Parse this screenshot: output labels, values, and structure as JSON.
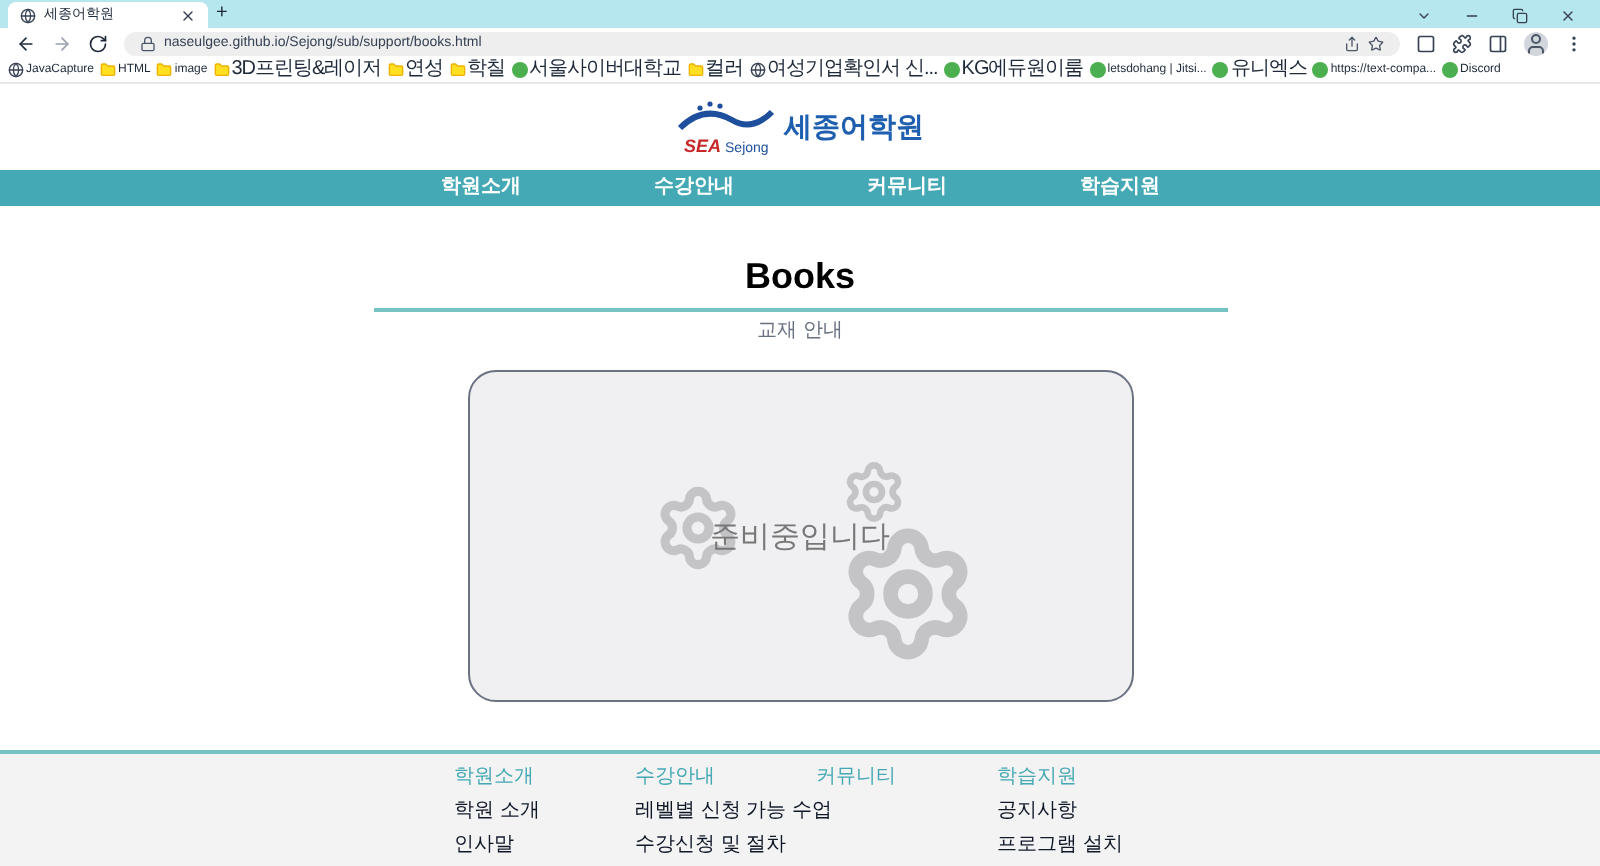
{
  "browser": {
    "tabs": [
      {
        "title": "세종어학원",
        "selected": true
      }
    ],
    "new_tab": "+",
    "url": "naseulgee.github.io/Sejong/sub/support/books.html",
    "bookmarks": [
      {
        "label": "JavaCapture",
        "kind": "globe"
      },
      {
        "label": "HTML",
        "kind": "folder"
      },
      {
        "label": "image",
        "kind": "folder"
      },
      {
        "label": "3D프린팅&레이저",
        "kind": "folder"
      },
      {
        "label": "연성",
        "kind": "folder"
      },
      {
        "label": "학칠",
        "kind": "folder"
      },
      {
        "label": "서울사이버대학교",
        "kind": "site"
      },
      {
        "label": "컬러",
        "kind": "folder"
      },
      {
        "label": "여성기업확인서 신...",
        "kind": "globe"
      },
      {
        "label": "KG에듀원이룸",
        "kind": "site"
      },
      {
        "label": "letsdohang | Jitsi...",
        "kind": "site"
      },
      {
        "label": "유니엑스",
        "kind": "site"
      },
      {
        "label": "https://text-compa...",
        "kind": "site"
      },
      {
        "label": "Discord",
        "kind": "site"
      }
    ]
  },
  "logo": {
    "mark": "SEA",
    "sub": "Sejong",
    "name": "세종어학원"
  },
  "nav": [
    "학원소개",
    "수강안내",
    "커뮤니티",
    "학습지원"
  ],
  "page": {
    "title": "Books",
    "subtitle": "교재 안내",
    "notice": "준비중입니다"
  },
  "footer": [
    {
      "heading": "학원소개",
      "links": [
        "학원 소개",
        "인사말"
      ]
    },
    {
      "heading": "수강안내",
      "links": [
        "레벨별 신청 가능 수업",
        "수강신청 및 절차"
      ]
    },
    {
      "heading": "커뮤니티"
    },
    {
      "heading": "학습지원",
      "links": [
        "공지사항",
        "프로그램 설치"
      ]
    }
  ]
}
